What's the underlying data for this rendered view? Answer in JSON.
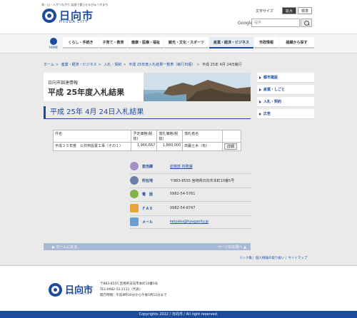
{
  "header": {
    "tagline": "海・山・人がつながり 笑顔で暮らせるひゅうがまち",
    "logo_text": "日向市",
    "logo_sub": "HYUGA CITY",
    "text_size_label": "文字サイズ",
    "size_large": "拡大",
    "size_standard": "標準",
    "search_label": "Google",
    "search_placeholder": "提供"
  },
  "nav": {
    "home": "HOME",
    "items": [
      "くらし・手続き",
      "子育て・教育",
      "健康・医療・福祉",
      "観光・文化・スポーツ",
      "産業・経済・ビジネス",
      "市政情報",
      "組織から探す"
    ]
  },
  "breadcrumb": [
    "ホーム",
    "産業・経済・ビジネス",
    "入札・契約",
    "平成 25年度入札結果一覧表（執行日順）",
    "平成 25年 4月 24日執行"
  ],
  "banner": {
    "subtitle": "日向市調達情報",
    "title": "平成 25年度入札結果"
  },
  "page_title": "平成 25年 4月 24日入札結果",
  "table": {
    "headers": [
      "件名",
      "予定価格(税抜)",
      "落札価格(税抜)",
      "落札者名",
      ""
    ],
    "rows": [
      [
        "平成２５年度　公共桝設置工事（その１）",
        "1,966,667",
        "1,880,000",
        "高藪土木（有）",
        "詳細"
      ]
    ]
  },
  "contact": {
    "department_label": "担当課",
    "department_value": "総務部 財務課",
    "address_label": "所在地",
    "address_value": "〒883-8555 宮崎県日向市本町10番5号",
    "phone_label": "電　話",
    "phone_value": "0982-54-5761",
    "fax_label": "ＦＡＸ",
    "fax_value": "0982-54-8747",
    "mail_label": "メール",
    "mail_value": "keiyaku@hyugacity.jp"
  },
  "back_bar": {
    "top": "ホームに戻る",
    "page": "ページの先頭へ"
  },
  "sidebar": [
    "都市建設",
    "産業・しごと",
    "入札・契約",
    "広告"
  ],
  "footer": {
    "links": [
      "リンク集",
      "個人情報の取り扱い",
      "サイトマップ"
    ],
    "name": "日向市",
    "sub": "HYUGA CITY",
    "address": "〒883-8555 宮崎県日向市本町10番5号",
    "tel": "TEL:0982-52-2111（代表）",
    "hours": "開庁時間：午前8時30分から午後5時15分まで",
    "copyright": "Copyrights 2022 / 日向市 / All right reserved."
  },
  "colors": {
    "brand": "#1d4b9c",
    "back_bar": "#a8b9d6",
    "icon_department": "#a58fc4",
    "icon_address": "#6c7fa8",
    "icon_phone": "#7fb24a",
    "icon_fax": "#e8a33a",
    "icon_mail": "#6a9ed3"
  }
}
